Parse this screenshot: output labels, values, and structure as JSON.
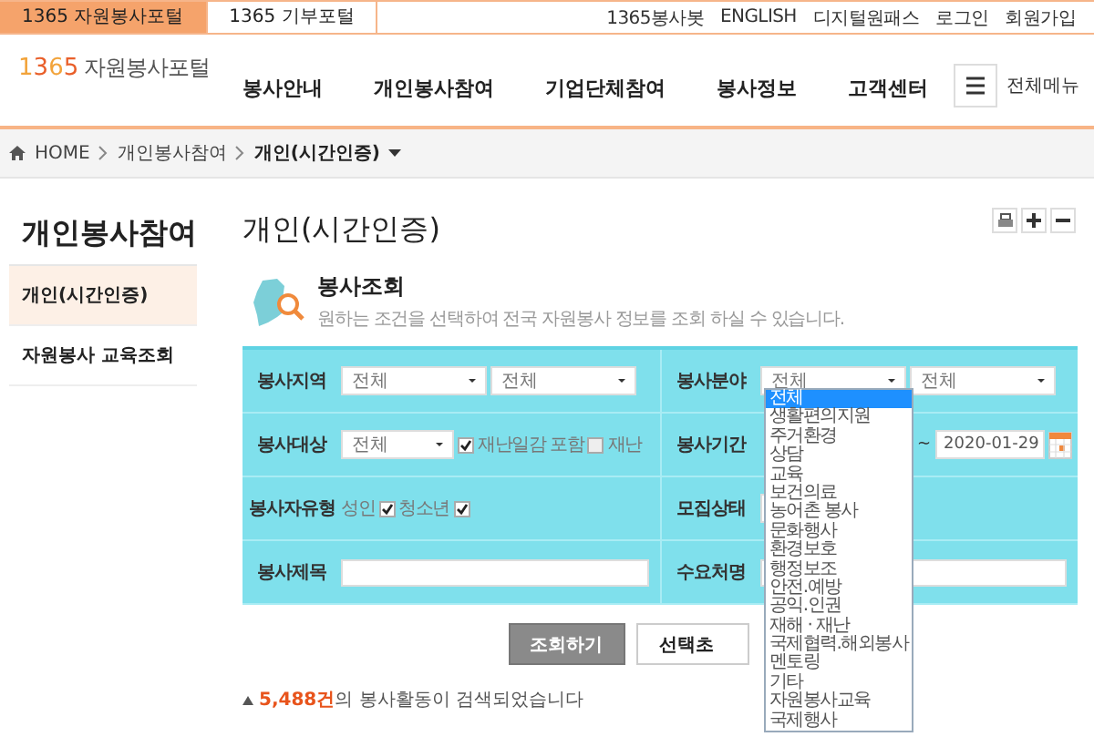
{
  "top_bar": {
    "tabs": [
      {
        "label": "1365 자원봉사포털",
        "selected": true
      },
      {
        "label": "1365 기부포털",
        "selected": false
      }
    ],
    "links": [
      "1365봉사봇",
      "ENGLISH",
      "디지털원패스",
      "로그인",
      "회원가입"
    ]
  },
  "header": {
    "logo_number": "1365",
    "logo_text": "자원봉사포털",
    "nav": [
      "봉사안내",
      "개인봉사참여",
      "기업단체참여",
      "봉사정보",
      "고객센터"
    ],
    "menu_button": "전체메뉴"
  },
  "breadcrumb": {
    "home": "HOME",
    "items": [
      "개인봉사참여",
      "개인(시간인증)"
    ]
  },
  "sidebar": {
    "title": "개인봉사참여",
    "items": [
      {
        "label": "개인(시간인증)",
        "selected": true
      },
      {
        "label": "자원봉사 교육조회",
        "selected": false
      }
    ]
  },
  "page_title": "개인(시간인증)",
  "search": {
    "title": "봉사조회",
    "description": "원하는 조건을 선택하여 전국 자원봉사 정보를 조회 하실 수 있습니다."
  },
  "form": {
    "rows": [
      [
        {
          "label": "봉사지역",
          "kind": "selects",
          "values": [
            "전체",
            "전체"
          ]
        },
        {
          "label": "봉사분야",
          "kind": "selects",
          "values": [
            "전체",
            "전체"
          ]
        }
      ],
      [
        {
          "label": "봉사대상",
          "kind": "select_checks",
          "values": [
            "전체"
          ],
          "checks": [
            {
              "label": "재난일감 포함",
              "checked": true
            },
            {
              "label": "재난",
              "checked": false
            }
          ]
        },
        {
          "label": "봉사기간",
          "kind": "date",
          "value": "~",
          "date": "2020-01-29"
        }
      ],
      [
        {
          "label": "봉사자유형",
          "kind": "checks",
          "checks": [
            {
              "label": "성인",
              "checked": true
            },
            {
              "label": "청소년",
              "checked": true
            }
          ]
        },
        {
          "label": "모집상태",
          "kind": "select"
        }
      ],
      [
        {
          "label": "봉사제목",
          "kind": "input"
        },
        {
          "label": "수요처명",
          "kind": "input"
        }
      ]
    ]
  },
  "dropdown": {
    "options": [
      {
        "label": "전체",
        "selected": true
      },
      {
        "label": "생활편의지원",
        "selected": false
      },
      {
        "label": "주거환경",
        "selected": false
      },
      {
        "label": "상담",
        "selected": false
      },
      {
        "label": "교육",
        "selected": false
      },
      {
        "label": "보건의료",
        "selected": false
      },
      {
        "label": "농어촌 봉사",
        "selected": false
      },
      {
        "label": "문화행사",
        "selected": false
      },
      {
        "label": "환경보호",
        "selected": false
      },
      {
        "label": "행정보조",
        "selected": false
      },
      {
        "label": "안전.예방",
        "selected": false
      },
      {
        "label": "공익.인권",
        "selected": false
      },
      {
        "label": "재해 · 재난",
        "selected": false
      },
      {
        "label": "국제협력.해외봉사",
        "selected": false
      },
      {
        "label": "멘토링",
        "selected": false
      },
      {
        "label": "기타",
        "selected": false
      },
      {
        "label": "자원봉사교육",
        "selected": false
      },
      {
        "label": "국제행사",
        "selected": false
      }
    ]
  },
  "buttons": [
    {
      "label": "조회하기",
      "kind": "primary"
    },
    {
      "label": "선택초",
      "kind": "secondary"
    }
  ],
  "result": {
    "count": "5,488건",
    "text": "의 봉사활동이 검색되었습니다"
  }
}
